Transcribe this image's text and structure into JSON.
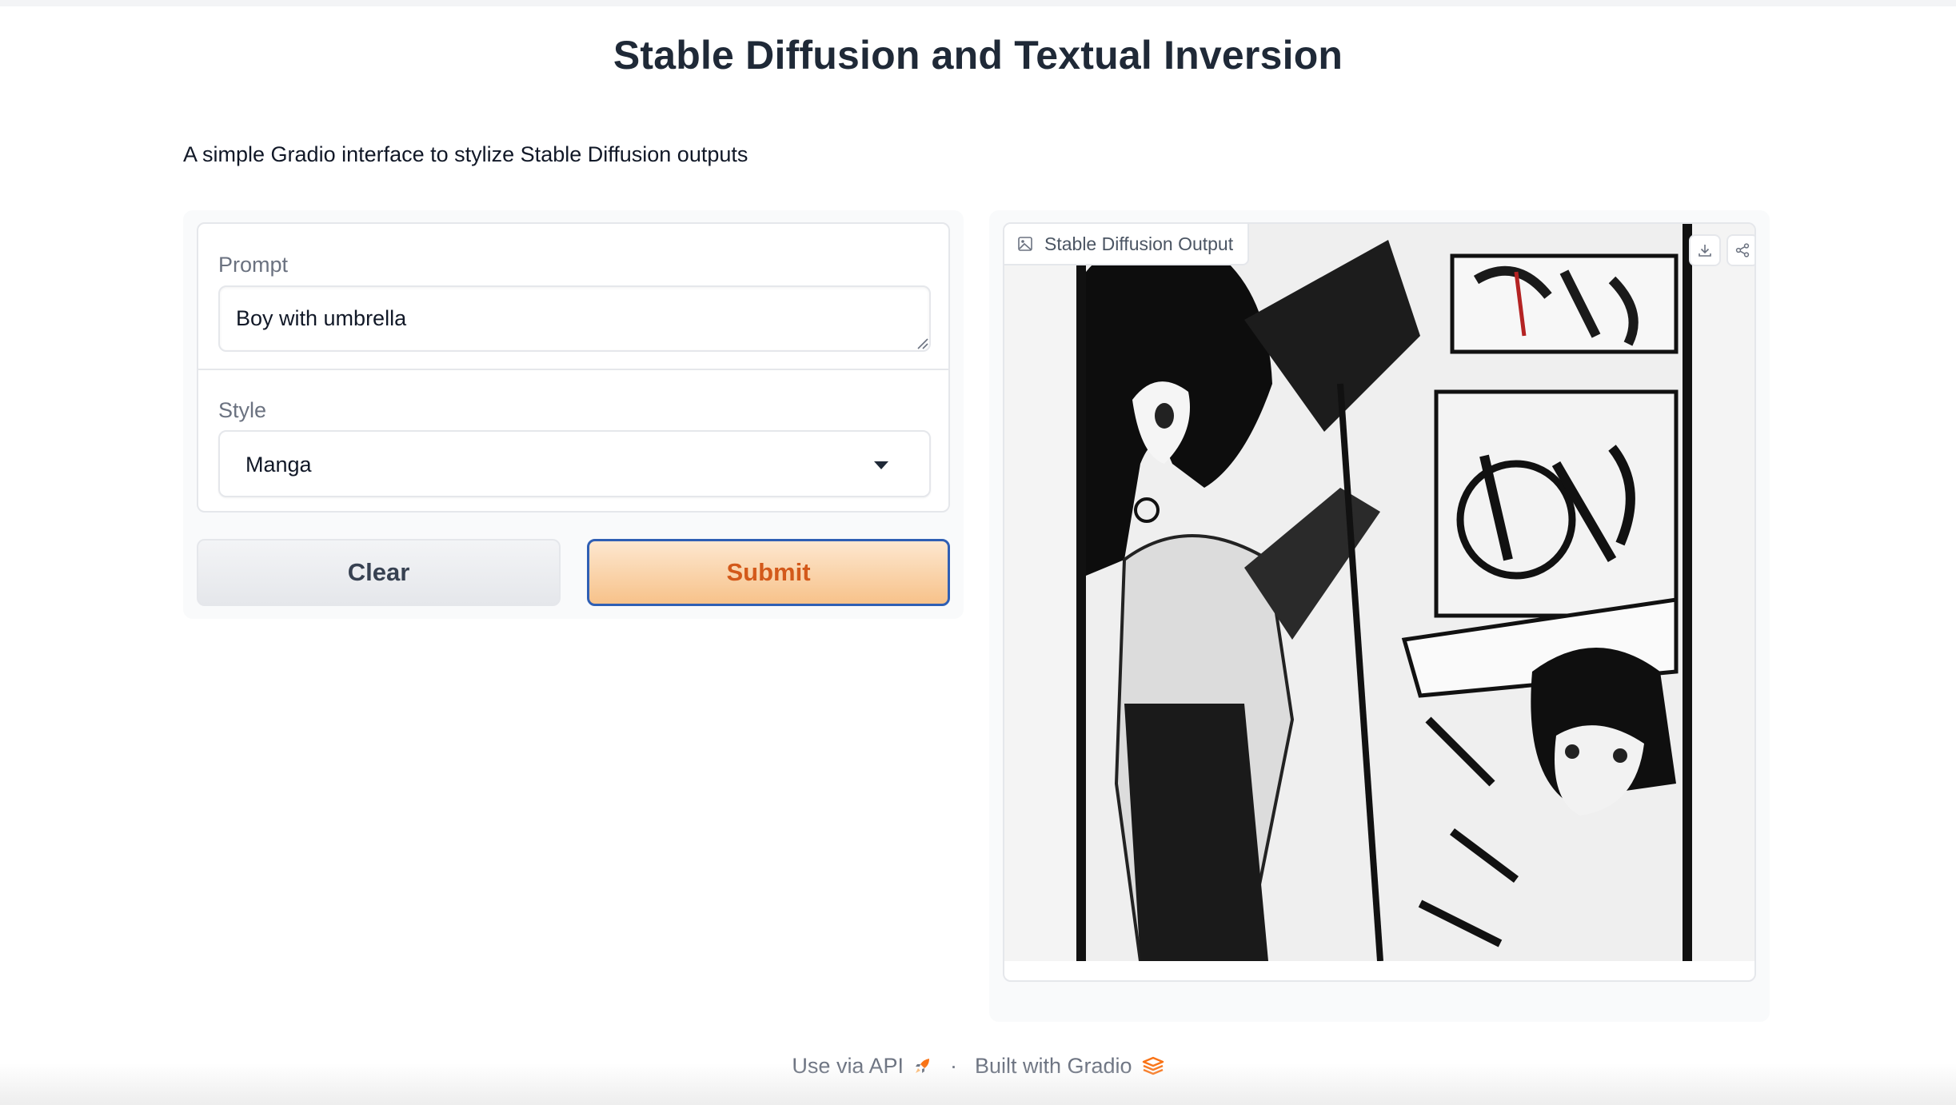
{
  "header": {
    "title": "Stable Diffusion and Textual Inversion",
    "description": "A simple Gradio interface to stylize Stable Diffusion outputs"
  },
  "form": {
    "prompt_label": "Prompt",
    "prompt_value": "Boy with umbrella",
    "style_label": "Style",
    "style_value": "Manga",
    "clear_label": "Clear",
    "submit_label": "Submit"
  },
  "output": {
    "label": "Stable Diffusion Output",
    "label_icon": "image-icon",
    "actions": [
      {
        "icon": "download-icon"
      },
      {
        "icon": "share-icon"
      }
    ]
  },
  "footer": {
    "api_label": "Use via API",
    "api_icon": "rocket-icon",
    "separator": "·",
    "built_label": "Built with Gradio",
    "built_icon": "gradio-logo-icon"
  },
  "colors": {
    "accent": "#f7c28a",
    "submit_text": "#d3591a",
    "focus_border": "#2f5fb4"
  }
}
